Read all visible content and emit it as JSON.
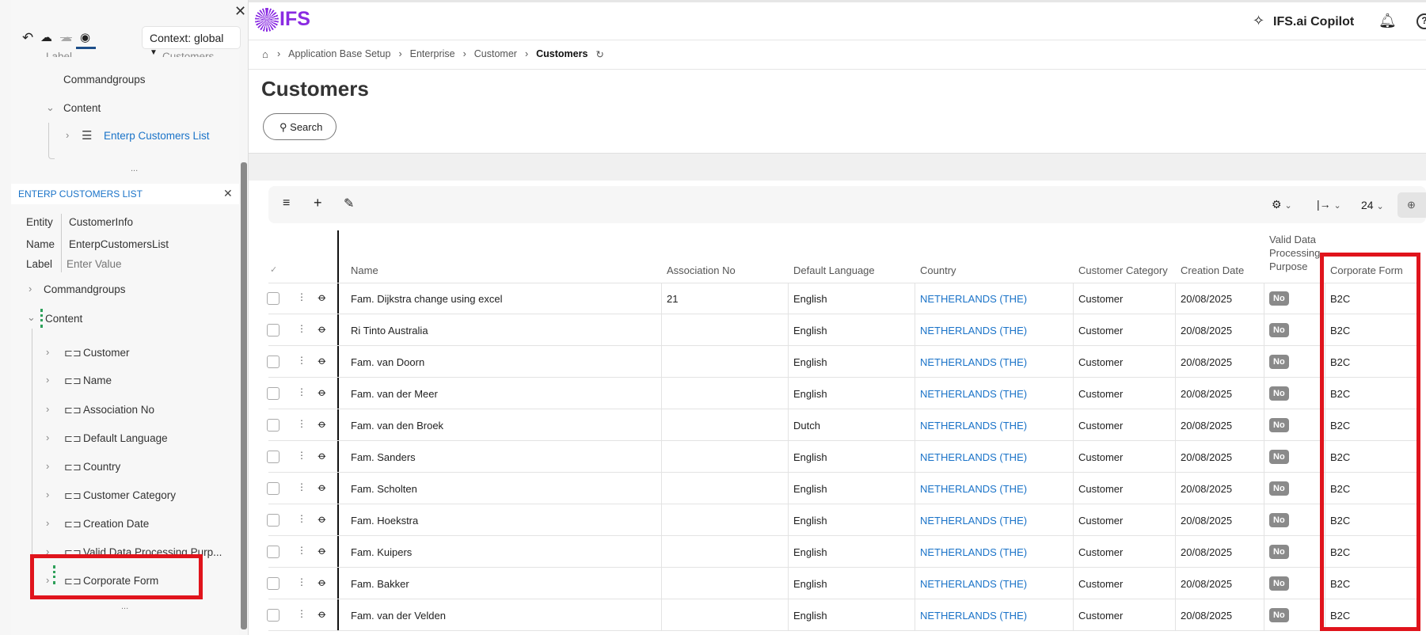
{
  "left_panel": {
    "context_label": "Context: global",
    "partial_label": "Label",
    "partial_value": "Customers",
    "top_tree": {
      "commandgroups": "Commandgroups",
      "content": "Content",
      "list_item": "Enterp Customers List",
      "more": "..."
    },
    "section_title": "ENTERP CUSTOMERS LIST",
    "props": [
      {
        "label": "Entity",
        "value": "CustomerInfo"
      },
      {
        "label": "Name",
        "value": "EnterpCustomersList"
      },
      {
        "label": "Label",
        "placeholder": "Enter Value"
      }
    ],
    "commandgroups": "Commandgroups",
    "content": "Content",
    "fields": [
      "Customer",
      "Name",
      "Association No",
      "Default Language",
      "Country",
      "Customer Category",
      "Creation Date",
      "Valid Data Processing Purp...",
      "Corporate Form"
    ],
    "more": "..."
  },
  "header": {
    "logo": "IFS",
    "copilot": "IFS.ai Copilot"
  },
  "breadcrumb": [
    "Application Base Setup",
    "Enterprise",
    "Customer",
    "Customers"
  ],
  "page_title": "Customers",
  "search_label": "Search",
  "toolbar": {
    "page_size": "24"
  },
  "table": {
    "columns": [
      "Name",
      "Association No",
      "Default Language",
      "Country",
      "Customer Category",
      "Creation Date",
      "Valid Data Processing Purpose",
      "Corporate Form"
    ],
    "rows": [
      [
        "Fam. Dijkstra change using excel",
        "21",
        "English",
        "NETHERLANDS (THE)",
        "Customer",
        "20/08/2025",
        "No",
        "B2C"
      ],
      [
        "Ri Tinto Australia",
        "",
        "English",
        "NETHERLANDS (THE)",
        "Customer",
        "20/08/2025",
        "No",
        "B2C"
      ],
      [
        "Fam. van Doorn",
        "",
        "English",
        "NETHERLANDS (THE)",
        "Customer",
        "20/08/2025",
        "No",
        "B2C"
      ],
      [
        "Fam. van der Meer",
        "",
        "English",
        "NETHERLANDS (THE)",
        "Customer",
        "20/08/2025",
        "No",
        "B2C"
      ],
      [
        "Fam. van den Broek",
        "",
        "Dutch",
        "NETHERLANDS (THE)",
        "Customer",
        "20/08/2025",
        "No",
        "B2C"
      ],
      [
        "Fam. Sanders",
        "",
        "English",
        "NETHERLANDS (THE)",
        "Customer",
        "20/08/2025",
        "No",
        "B2C"
      ],
      [
        "Fam. Scholten",
        "",
        "English",
        "NETHERLANDS (THE)",
        "Customer",
        "20/08/2025",
        "No",
        "B2C"
      ],
      [
        "Fam. Hoekstra",
        "",
        "English",
        "NETHERLANDS (THE)",
        "Customer",
        "20/08/2025",
        "No",
        "B2C"
      ],
      [
        "Fam. Kuipers",
        "",
        "English",
        "NETHERLANDS (THE)",
        "Customer",
        "20/08/2025",
        "No",
        "B2C"
      ],
      [
        "Fam. Bakker",
        "",
        "English",
        "NETHERLANDS (THE)",
        "Customer",
        "20/08/2025",
        "No",
        "B2C"
      ],
      [
        "Fam. van der Velden",
        "",
        "English",
        "NETHERLANDS (THE)",
        "Customer",
        "20/08/2025",
        "No",
        "B2C"
      ]
    ]
  },
  "colors": {
    "brand": "#8a2be2",
    "link": "#1a73c8",
    "highlight": "#e0141c"
  }
}
